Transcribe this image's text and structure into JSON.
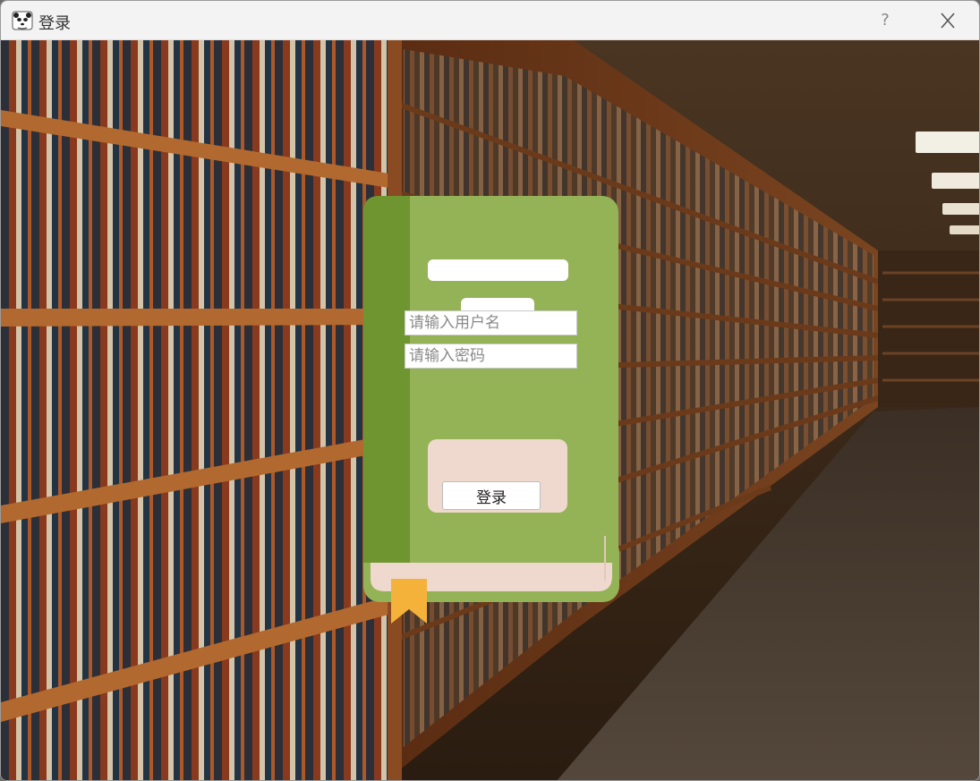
{
  "window": {
    "title": "登录",
    "help_label": "?"
  },
  "login": {
    "username_placeholder": "请输入用户名",
    "password_placeholder": "请输入密码",
    "login_button": "登录"
  },
  "colors": {
    "book_cover": "#94b256",
    "book_spine": "#6e9530",
    "book_pages": "#efd9cf",
    "bookmark": "#f5b23a",
    "titlebar": "#f3f3f3"
  },
  "icons": {
    "app": "panda-avatar-icon",
    "help": "question-mark-icon",
    "close": "close-icon",
    "bookmark": "bookmark-icon"
  }
}
